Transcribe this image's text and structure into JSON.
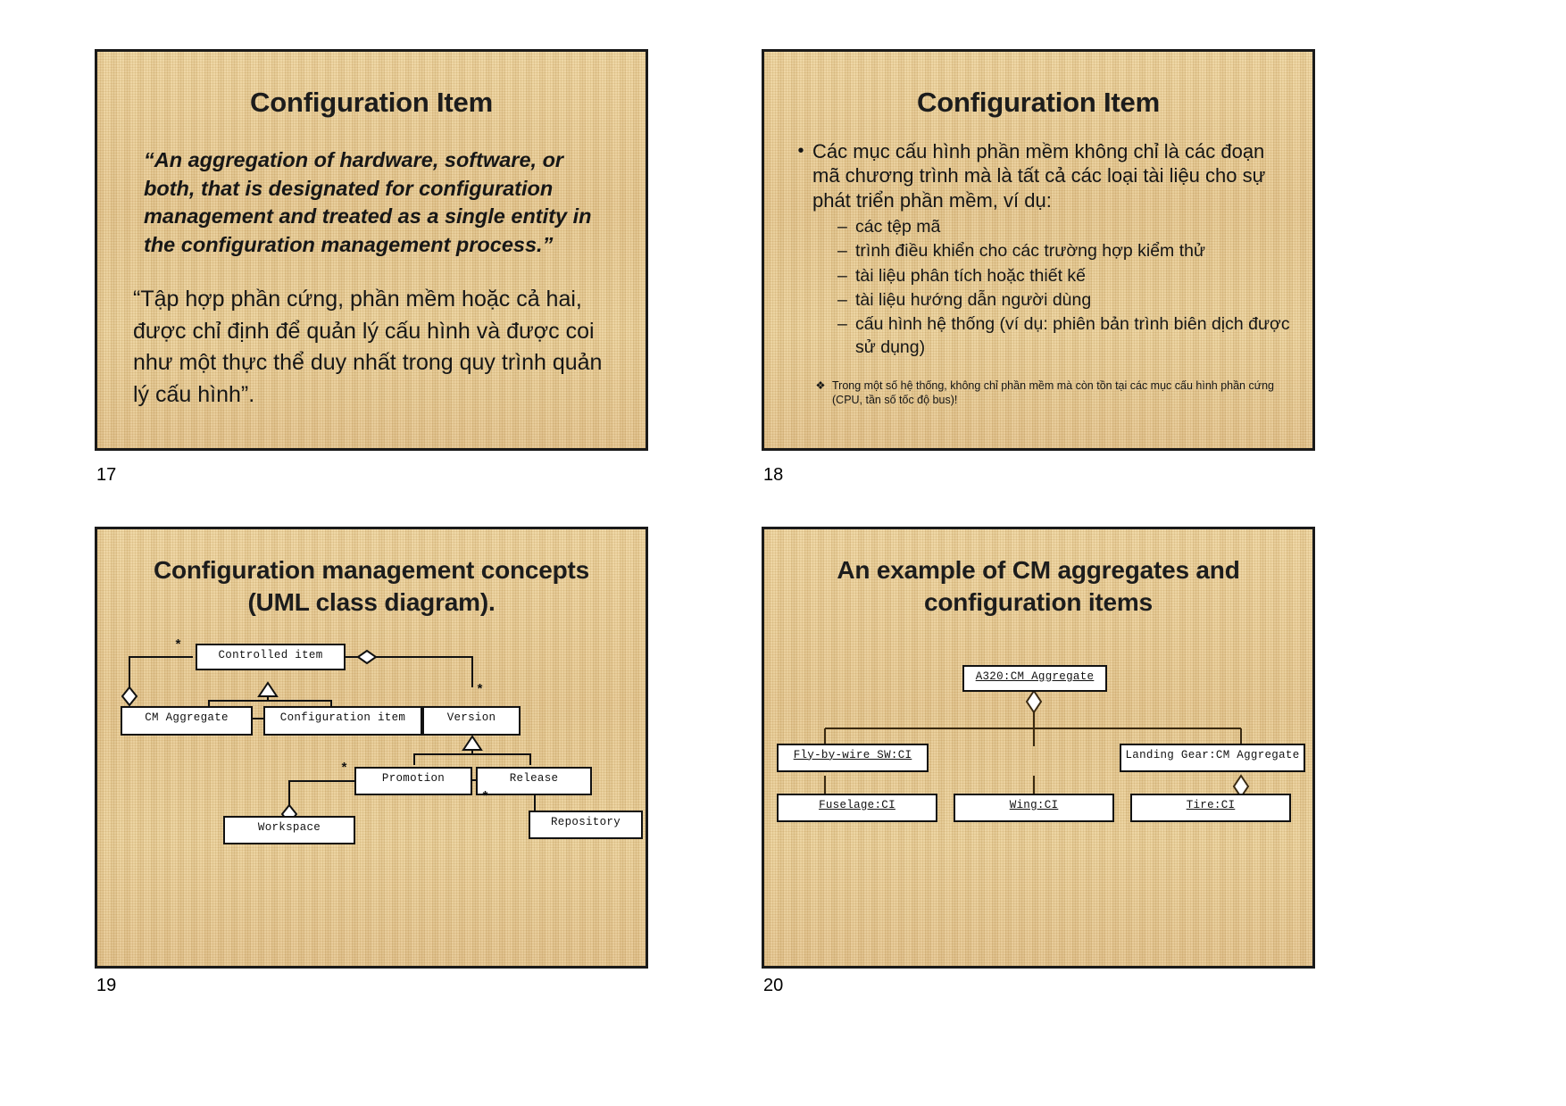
{
  "slides": [
    {
      "number": "17",
      "title": "Configuration Item",
      "quote_en": "“An aggregation of hardware, software, or both, that is designated for configuration management and treated as a single entity in the configuration management process.”",
      "quote_vi": "“Tập hợp phần cứng, phần mềm hoặc cả hai, được chỉ định để quản lý cấu hình và được coi như một thực thể duy nhất trong quy trình quản lý cấu hình”."
    },
    {
      "number": "18",
      "title": "Configuration Item",
      "bullet_marker": "•",
      "bullet_main": "Các mục cấu hình phần mềm không chỉ là các đoạn mã chương trình mà là tất cả các loại tài liệu cho sự phát triển phần mềm, ví dụ:",
      "sub_marker": "–",
      "sub_items": [
        "các tệp mã",
        "trình điều khiển cho các trường hợp kiểm thử",
        "tài liệu phân tích hoặc thiết kế",
        "tài liệu hướng dẫn người dùng",
        "cấu hình hệ thống (ví dụ: phiên bản trình biên dịch được sử dụng)"
      ],
      "note_marker": "❖",
      "note": "Trong một số hệ thống, không chỉ phần mềm mà còn tồn tại các mục cấu hình phần cứng (CPU, tần số tốc độ bus)!"
    },
    {
      "number": "19",
      "title_line1": "Configuration management concepts",
      "title_line2": "(UML class diagram).",
      "nodes": [
        {
          "id": "controlled-item",
          "label": "Controlled item"
        },
        {
          "id": "cm-aggregate",
          "label": "CM Aggregate"
        },
        {
          "id": "configuration-item",
          "label": "Configuration item"
        },
        {
          "id": "version",
          "label": "Version"
        },
        {
          "id": "promotion",
          "label": "Promotion"
        },
        {
          "id": "release",
          "label": "Release"
        },
        {
          "id": "workspace",
          "label": "Workspace"
        },
        {
          "id": "repository",
          "label": "Repository"
        }
      ],
      "multiplicities": [
        "*",
        "*",
        "*",
        "*"
      ]
    },
    {
      "number": "20",
      "title_line1": "An example of CM aggregates and",
      "title_line2": "configuration items",
      "nodes": [
        {
          "id": "a320",
          "label": "A320:CM Aggregate"
        },
        {
          "id": "fly-by-wire",
          "label": "Fly-by-wire SW:CI"
        },
        {
          "id": "landing-gear",
          "label": "Landing Gear:CM Aggregate"
        },
        {
          "id": "fuselage",
          "label": "Fuselage:CI"
        },
        {
          "id": "wing",
          "label": "Wing:CI"
        },
        {
          "id": "tire",
          "label": "Tire:CI"
        }
      ]
    }
  ]
}
